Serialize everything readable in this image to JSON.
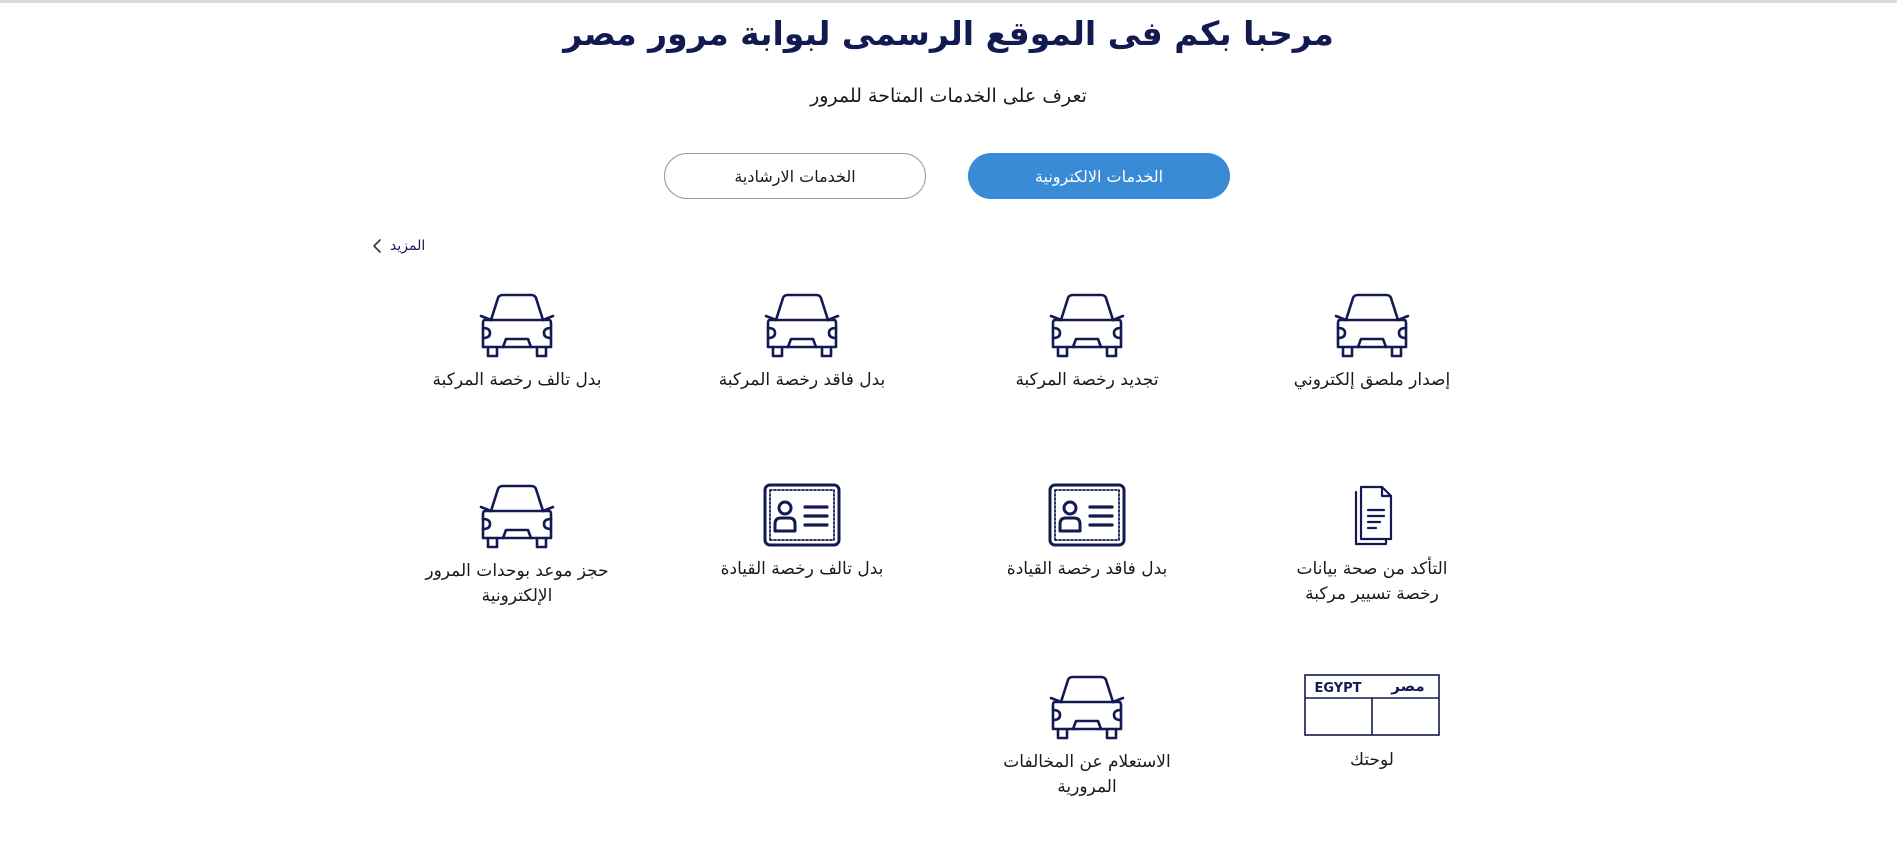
{
  "header": {
    "title": "مرحبا بكم فى الموقع الرسمى لبوابة مرور مصر",
    "subtitle": "تعرف على الخدمات المتاحة للمرور"
  },
  "tabs": {
    "electronic": "الخدمات الالكترونية",
    "guidance": "الخدمات الارشادية"
  },
  "more_link": "المزيد",
  "services": [
    {
      "label": "إصدار ملصق إلكتروني",
      "icon": "car-icon"
    },
    {
      "label": "تجديد رخصة المركبة",
      "icon": "car-icon"
    },
    {
      "label": "بدل فاقد رخصة المركبة",
      "icon": "car-icon"
    },
    {
      "label": "بدل تالف رخصة المركبة",
      "icon": "car-icon"
    },
    {
      "label": "التأكد من صحة بيانات رخصة تسيير مركبة",
      "icon": "document-icon"
    },
    {
      "label": "بدل فاقد رخصة القيادة",
      "icon": "id-card-icon"
    },
    {
      "label": "بدل تالف رخصة القيادة",
      "icon": "id-card-icon"
    },
    {
      "label": "حجز موعد بوحدات المرور الإلكترونية",
      "icon": "car-icon"
    },
    {
      "label": "لوحتك",
      "icon": "license-plate-icon"
    },
    {
      "label": "الاستعلام عن المخالفات المرورية",
      "icon": "car-icon"
    }
  ],
  "plate": {
    "left_text": "EGYPT",
    "right_text": "مصر"
  },
  "colors": {
    "primary": "#3a8bd5",
    "navy": "#131a52"
  }
}
